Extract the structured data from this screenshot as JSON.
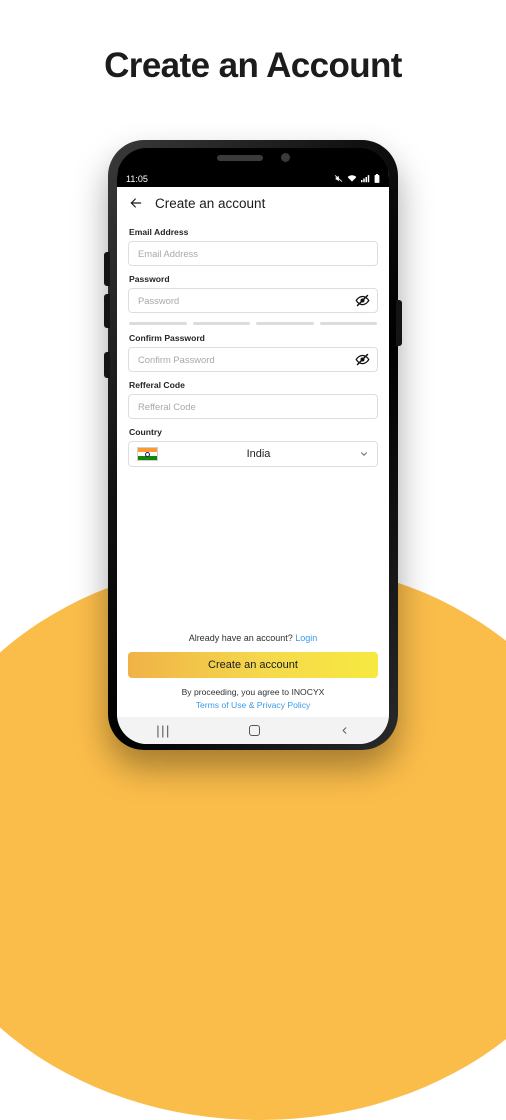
{
  "page": {
    "title": "Create an Account",
    "background_color": "#FFFFFF",
    "accent_color": "#FBBD4A"
  },
  "phone": {
    "status_bar": {
      "time": "11:05",
      "icons": [
        "mute-icon",
        "wifi-icon",
        "signal-icon",
        "battery-icon"
      ]
    },
    "app_bar": {
      "back_icon": "back-arrow-icon",
      "title": "Create an account"
    },
    "form": {
      "fields": [
        {
          "label": "Email Address",
          "placeholder": "Email Address",
          "value": "",
          "type": "email"
        },
        {
          "label": "Password",
          "placeholder": "Password",
          "value": "",
          "type": "password"
        },
        {
          "label": "Confirm Password",
          "placeholder": "Confirm Password",
          "value": "",
          "type": "password"
        },
        {
          "label": "Refferal Code",
          "placeholder": "Refferal Code",
          "value": "",
          "type": "text"
        }
      ],
      "password_strength": {
        "segments": 4,
        "filled": 0,
        "empty_color": "#DCDCDC"
      },
      "country": {
        "label": "Country",
        "selected": "India",
        "flag": "india-flag-icon",
        "chevron": "chevron-down-icon"
      }
    },
    "bottom": {
      "login_prompt": "Already have an account?",
      "login_link": "Login",
      "submit_label": "Create an account",
      "submit_gradient_from": "#F0B247",
      "submit_gradient_to": "#F7E940",
      "terms_prefix": "By proceeding, you agree to INOCYX",
      "terms_link": "Terms of Use & Privacy Policy",
      "link_color": "#3B9BE8"
    },
    "nav_bar": {
      "recents": "|||",
      "home": "home-square-icon",
      "back": "back-chevron-icon"
    }
  }
}
